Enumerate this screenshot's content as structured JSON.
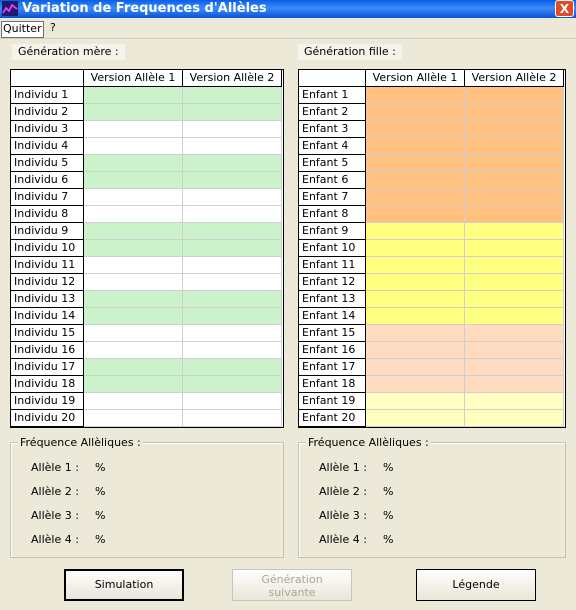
{
  "window": {
    "title": "Variation de Frequences d'Allèles",
    "close_label": "X"
  },
  "menu": {
    "quit_label": "Quitter",
    "help_label": "?"
  },
  "mother": {
    "title": "Génération mère :",
    "columns": [
      "Version Allèle 1",
      "Version Allèle 2"
    ],
    "rows": [
      {
        "label": "Individu 1",
        "color": "#ccf2cc"
      },
      {
        "label": "Individu 2",
        "color": "#ccf2cc"
      },
      {
        "label": "Individu 3",
        "color": "#ffffff"
      },
      {
        "label": "Individu 4",
        "color": "#ffffff"
      },
      {
        "label": "Individu 5",
        "color": "#ccf2cc"
      },
      {
        "label": "Individu 6",
        "color": "#ccf2cc"
      },
      {
        "label": "Individu 7",
        "color": "#ffffff"
      },
      {
        "label": "Individu 8",
        "color": "#ffffff"
      },
      {
        "label": "Individu 9",
        "color": "#ccf2cc"
      },
      {
        "label": "Individu 10",
        "color": "#ccf2cc"
      },
      {
        "label": "Individu 11",
        "color": "#ffffff"
      },
      {
        "label": "Individu 12",
        "color": "#ffffff"
      },
      {
        "label": "Individu 13",
        "color": "#ccf2cc"
      },
      {
        "label": "Individu 14",
        "color": "#ccf2cc"
      },
      {
        "label": "Individu 15",
        "color": "#ffffff"
      },
      {
        "label": "Individu 16",
        "color": "#ffffff"
      },
      {
        "label": "Individu 17",
        "color": "#ccf2cc"
      },
      {
        "label": "Individu 18",
        "color": "#ccf2cc"
      },
      {
        "label": "Individu 19",
        "color": "#ffffff"
      },
      {
        "label": "Individu 20",
        "color": "#ffffff"
      }
    ],
    "freq_title": "Fréquence Allèliques :",
    "freqs": [
      {
        "label": "Allèle 1 :",
        "value": "%"
      },
      {
        "label": "Allèle 2 :",
        "value": "%"
      },
      {
        "label": "Allèle 3 :",
        "value": "%"
      },
      {
        "label": "Allèle 4 :",
        "value": "%"
      }
    ]
  },
  "daughter": {
    "title": "Génération fille :",
    "columns": [
      "Version Allèle 1",
      "Version Allèle 2"
    ],
    "rows": [
      {
        "label": "Enfant  1",
        "color": "#ffc080"
      },
      {
        "label": "Enfant  2",
        "color": "#ffc080"
      },
      {
        "label": "Enfant  3",
        "color": "#ffc080"
      },
      {
        "label": "Enfant  4",
        "color": "#ffc080"
      },
      {
        "label": "Enfant  5",
        "color": "#ffc080"
      },
      {
        "label": "Enfant  6",
        "color": "#ffc080"
      },
      {
        "label": "Enfant  7",
        "color": "#ffc080"
      },
      {
        "label": "Enfant  8",
        "color": "#ffc080"
      },
      {
        "label": "Enfant  9",
        "color": "#ffff80"
      },
      {
        "label": "Enfant  10",
        "color": "#ffff80"
      },
      {
        "label": "Enfant  11",
        "color": "#ffff80"
      },
      {
        "label": "Enfant  12",
        "color": "#ffff80"
      },
      {
        "label": "Enfant  13",
        "color": "#ffff80"
      },
      {
        "label": "Enfant  14",
        "color": "#ffff80"
      },
      {
        "label": "Enfant  15",
        "color": "#ffdcc0"
      },
      {
        "label": "Enfant  16",
        "color": "#ffdcc0"
      },
      {
        "label": "Enfant  17",
        "color": "#ffdcc0"
      },
      {
        "label": "Enfant  18",
        "color": "#ffdcc0"
      },
      {
        "label": "Enfant  19",
        "color": "#ffffc0"
      },
      {
        "label": "Enfant  20",
        "color": "#ffffc0"
      }
    ],
    "freq_title": "Fréquence Allèliques :",
    "freqs": [
      {
        "label": "Allèle 1 :",
        "value": "%"
      },
      {
        "label": "Allèle 2 :",
        "value": "%"
      },
      {
        "label": "Allèle 3 :",
        "value": "%"
      },
      {
        "label": "Allèle 4 :",
        "value": "%"
      }
    ]
  },
  "buttons": {
    "simulation": "Simulation",
    "next_line1": "Génération",
    "next_line2": "suivante",
    "legend": "Légende"
  }
}
